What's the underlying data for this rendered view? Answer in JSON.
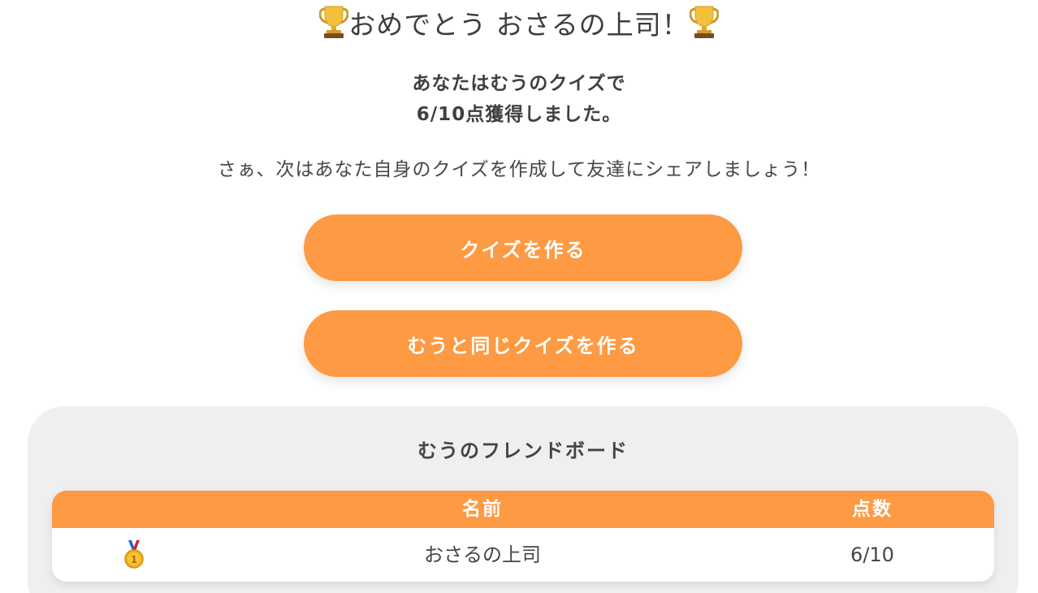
{
  "headline": {
    "text": "おめでとう おさるの上司！",
    "icon": "trophy"
  },
  "score": {
    "line1": "あなたはむうのクイズで",
    "line2": "6/10点獲得しました。"
  },
  "invite": "さぁ、次はあなた自身のクイズを作成して友達にシェアしましょう！",
  "buttons": {
    "create_quiz": "クイズを作る",
    "create_same_quiz": "むうと同じクイズを作る"
  },
  "board": {
    "title": "むうのフレンドボード",
    "headers": {
      "name": "名前",
      "score": "点数"
    },
    "rows": [
      {
        "medal": "gold-medal-1",
        "name": "おさるの上司",
        "score": "6/10"
      }
    ]
  },
  "colors": {
    "accent": "#fd9a43",
    "board_background": "#efefef",
    "text": "#404040"
  }
}
